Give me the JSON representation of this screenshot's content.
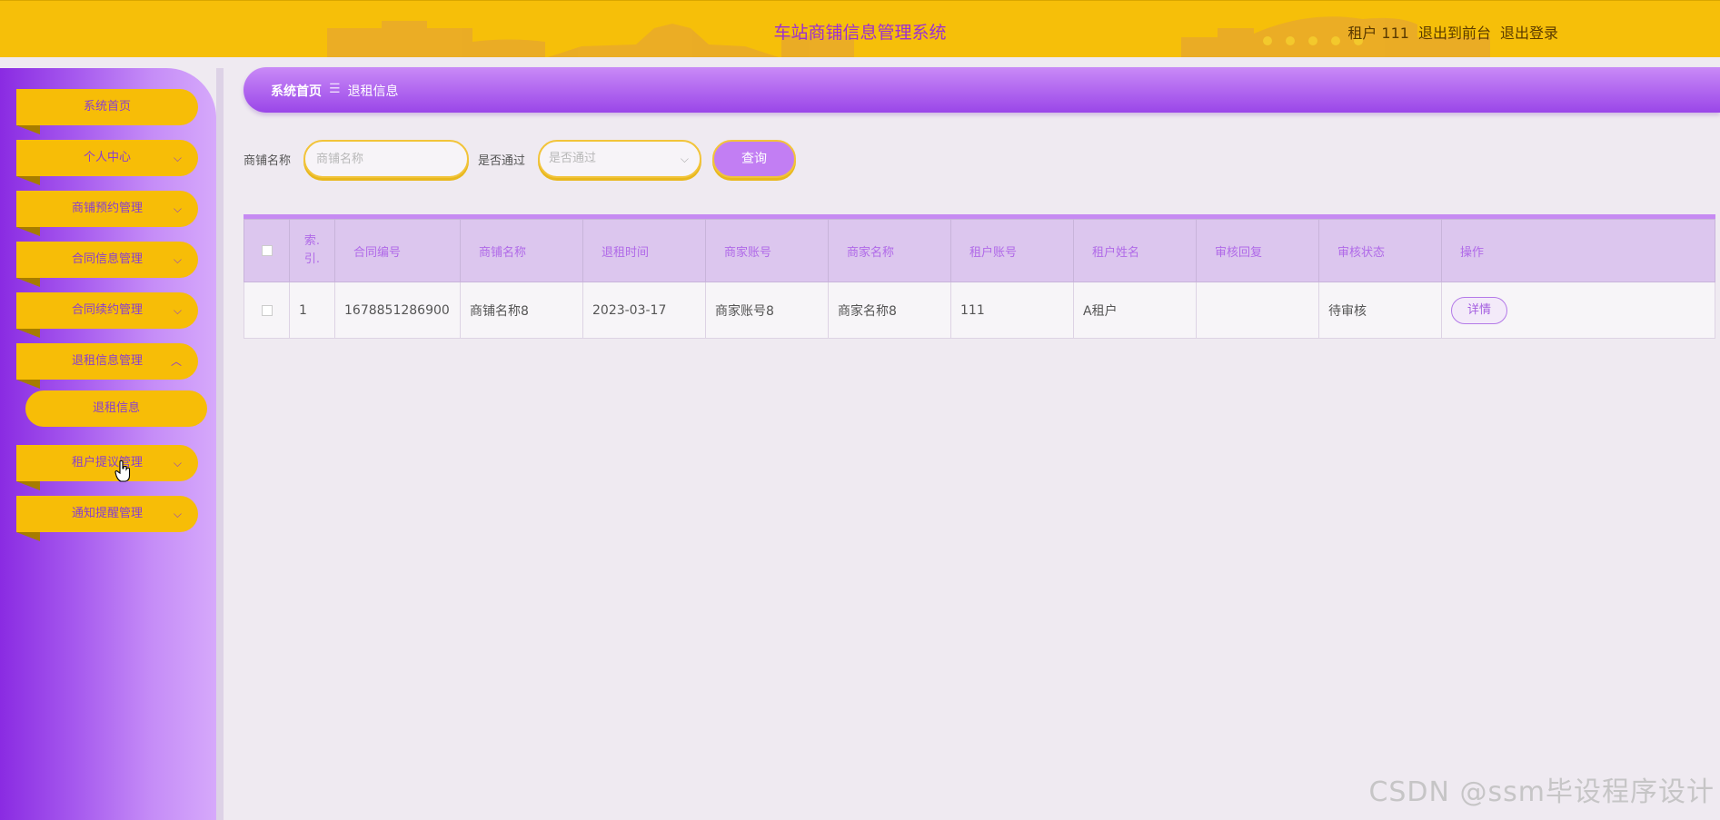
{
  "header": {
    "title": "车站商铺信息管理系统",
    "user_label": "租户 111",
    "front_link": "退出到前台",
    "logout_link": "退出登录"
  },
  "sidebar": {
    "items": [
      {
        "label": "系统首页",
        "has_chevron": false
      },
      {
        "label": "个人中心",
        "has_chevron": true
      },
      {
        "label": "商铺预约管理",
        "has_chevron": true
      },
      {
        "label": "合同信息管理",
        "has_chevron": true
      },
      {
        "label": "合同续约管理",
        "has_chevron": true
      },
      {
        "label": "退租信息管理",
        "has_chevron": true,
        "expanded": true
      },
      {
        "label": "租户提议管理",
        "has_chevron": true
      },
      {
        "label": "通知提醒管理",
        "has_chevron": true
      }
    ],
    "sub_items": [
      {
        "label": "退租信息"
      }
    ]
  },
  "breadcrumb": {
    "home": "系统首页",
    "separator": "☰",
    "current": "退租信息"
  },
  "search": {
    "shop_name_label": "商铺名称",
    "shop_name_placeholder": "商铺名称",
    "passed_label": "是否通过",
    "passed_placeholder": "是否通过",
    "query_button": "查询"
  },
  "table": {
    "headers": [
      "索引",
      "合同编号",
      "商铺名称",
      "退租时间",
      "商家账号",
      "商家名称",
      "租户账号",
      "租户姓名",
      "审核回复",
      "审核状态",
      "操作"
    ],
    "index_header_lines": [
      "索.",
      "引."
    ],
    "rows": [
      {
        "index": "1",
        "contract_no": "1678851286900",
        "shop_name": "商铺名称8",
        "return_time": "2023-03-17",
        "merchant_account": "商家账号8",
        "merchant_name": "商家名称8",
        "tenant_account": "111",
        "tenant_name": "A租户",
        "review_reply": "",
        "review_status": "待审核",
        "action": "详情"
      }
    ]
  },
  "watermark": "CSDN @ssm毕设程序设计",
  "colors": {
    "header_bg": "#f6bf09",
    "accent_purple": "#9a46e8",
    "menu_yellow": "#f7bd07",
    "page_bg": "#efeaf1"
  }
}
